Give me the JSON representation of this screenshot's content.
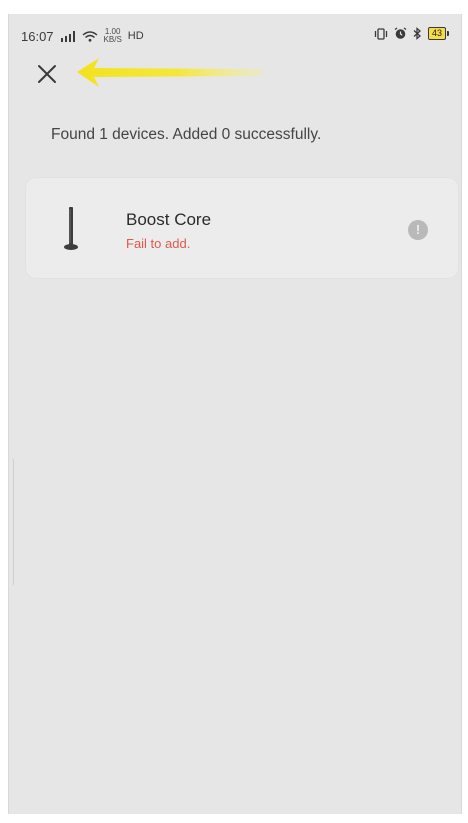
{
  "status_bar": {
    "time": "16:07",
    "net_speed_value": "1.00",
    "net_speed_unit": "KB/S",
    "hd": "HD",
    "battery": "43"
  },
  "header": {
    "close_icon": "close-icon"
  },
  "summary": {
    "text": "Found 1 devices. Added 0 successfully."
  },
  "devices": [
    {
      "name": "Boost Core",
      "status": "Fail to add.",
      "status_color": "#e0584b"
    }
  ],
  "colors": {
    "background": "#e6e6e6",
    "card": "#ececec",
    "error": "#e0584b",
    "annotation_arrow": "#f5e52a"
  }
}
